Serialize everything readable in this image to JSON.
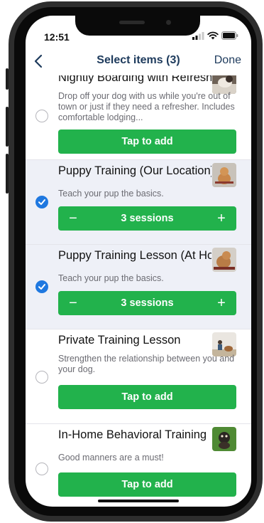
{
  "status": {
    "time": "12:51"
  },
  "nav": {
    "back_icon": "chevron-left-icon",
    "title": "Select items (3)",
    "done_label": "Done"
  },
  "colors": {
    "accent_green": "#22b24c",
    "nav_text": "#1d3a5c",
    "check_blue": "#1f78e0",
    "selected_bg": "#eef0f7"
  },
  "items": [
    {
      "title": "Nightly Boarding with Refresher",
      "description": "Drop off your dog with us while you're out of town or just if they need a refresher. Includes comfortable lodging...",
      "selected": false,
      "action_label": "Tap to add",
      "thumbnail": "dog-photo"
    },
    {
      "title": "Puppy Training (Our Location)",
      "description": "Teach your pup the basics.",
      "selected": true,
      "quantity_label": "3 sessions",
      "thumbnail": "puppy-photo"
    },
    {
      "title": "Puppy Training Lesson (At Home)",
      "description": "Teach your pup the basics.",
      "selected": true,
      "quantity_label": "3 sessions",
      "thumbnail": "puppy-photo"
    },
    {
      "title": "Private Training Lesson",
      "description": "Strengthen the relationship between you and your dog.",
      "selected": false,
      "action_label": "Tap to add",
      "thumbnail": "trainer-photo"
    },
    {
      "title": "In-Home Behavioral Training",
      "description": "Good manners are a must!",
      "selected": false,
      "action_label": "Tap to add",
      "thumbnail": "dog-grass-photo"
    }
  ]
}
